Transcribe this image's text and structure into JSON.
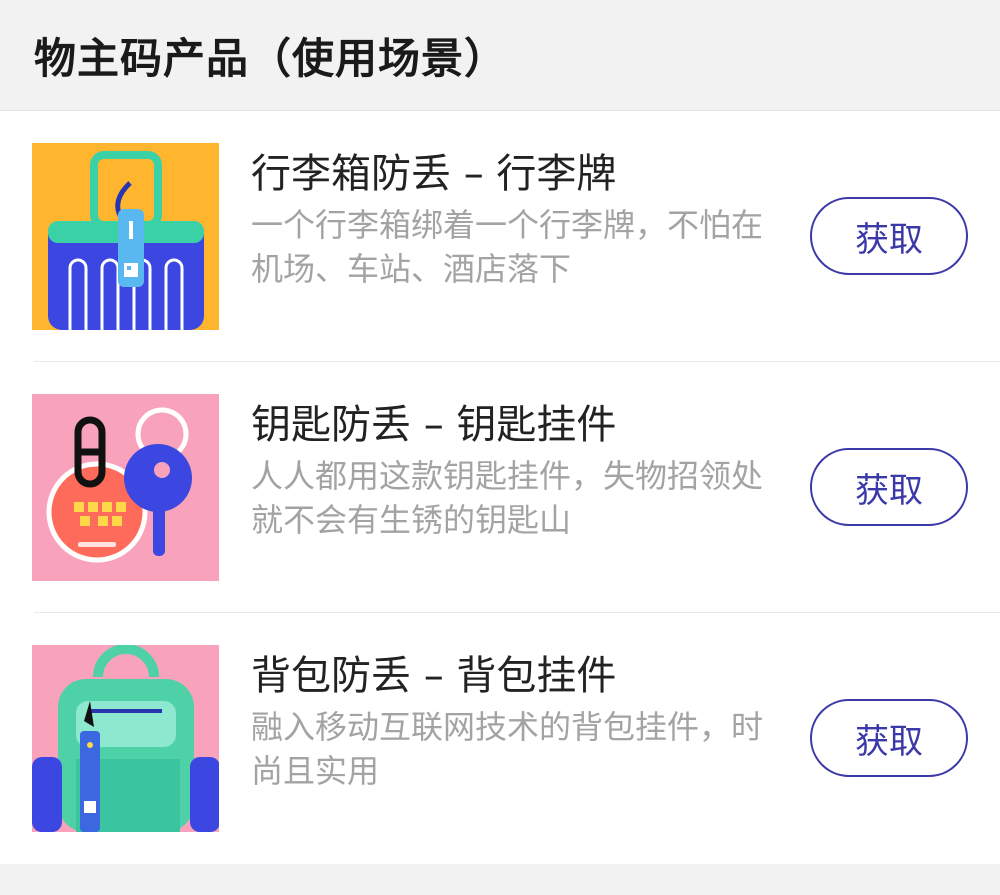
{
  "header": {
    "title": "物主码产品（使用场景）"
  },
  "products": [
    {
      "title": "行李箱防丢 – 行李牌",
      "description": "一个行李箱绑着一个行李牌，不怕在机场、车站、酒店落下",
      "button_label": "获取",
      "thumb_icon": "luggage-icon"
    },
    {
      "title": "钥匙防丢 – 钥匙挂件",
      "description": "人人都用这款钥匙挂件，失物招领处就不会有生锈的钥匙山",
      "button_label": "获取",
      "thumb_icon": "keys-icon"
    },
    {
      "title": "背包防丢 – 背包挂件",
      "description": "融入移动互联网技术的背包挂件，时尚且实用",
      "button_label": "获取",
      "thumb_icon": "backpack-icon"
    }
  ],
  "colors": {
    "accent": "#3b39a8",
    "luggage_bg": "#ffb52e",
    "keys_bg": "#f8a3bb",
    "backpack_bg": "#f8a3bb",
    "item_blue": "#3b47e0",
    "teal": "#4fd1a8"
  }
}
